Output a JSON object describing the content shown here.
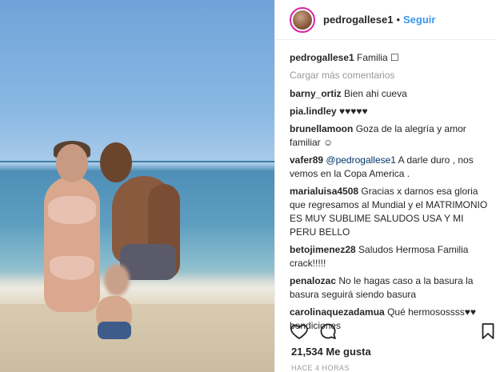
{
  "post": {
    "username": "pedrogallese1",
    "dot": "•",
    "follow_label": "Seguir",
    "caption_user": "pedrogallese1",
    "caption_text": "Familia ☐",
    "load_more": "Cargar más comentarios",
    "likes": "21,534 Me gusta",
    "timestamp": "HACE 4 HORAS"
  },
  "comments": [
    {
      "user": "barny_ortiz",
      "text": "Bien ahi cueva"
    },
    {
      "user": "pia.lindley",
      "text": "♥♥♥♥♥"
    },
    {
      "user": "brunellamoon",
      "text": "Goza de la alegría y amor familiar ☺"
    },
    {
      "user": "vafer89",
      "mention": "@pedrogallese1",
      "text": "A darle duro , nos vemos en la Copa America ."
    },
    {
      "user": "marialuisa4508",
      "text": "Gracias x darnos esa gloria que regresamos al Mundial y el MATRIMONIO ES MUY SUBLIME SALUDOS USA Y MI PERU BELLO"
    },
    {
      "user": "betojimenez28",
      "text": "Saludos Hermosa Familia crack!!!!!"
    },
    {
      "user": "penalozac",
      "text": "No le hagas caso a la basura la basura seguirá siendo basura"
    },
    {
      "user": "carolinaquezadamua",
      "text": "Qué hermosossss♥♥ bendiciones"
    }
  ],
  "icons": [
    "heart-icon",
    "comment-icon",
    "bookmark-icon"
  ]
}
